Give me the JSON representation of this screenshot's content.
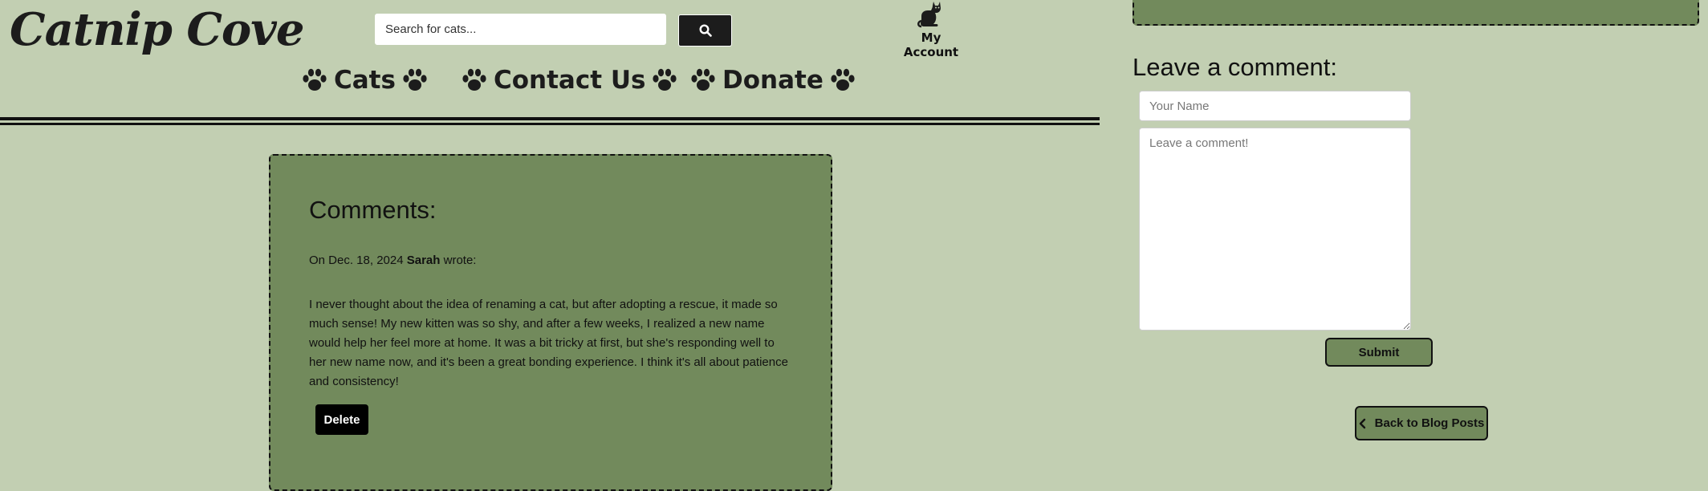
{
  "brand": {
    "name": "Catnip Cove"
  },
  "search": {
    "placeholder": "Search for cats...",
    "button_icon": "search-icon"
  },
  "account": {
    "label": "My Account",
    "icon": "cat-icon"
  },
  "nav": {
    "items": [
      {
        "label": "Cats",
        "icon": "paw-icon"
      },
      {
        "label": "Contact Us",
        "icon": "paw-icon"
      },
      {
        "label": "Donate",
        "icon": "paw-icon"
      }
    ]
  },
  "comments": {
    "title": "Comments:",
    "items": [
      {
        "date_prefix": "On Dec. 18, 2024 ",
        "author": "Sarah",
        "suffix": " wrote:",
        "text": "I never thought about the idea of renaming a cat, but after adopting a rescue, it made so much sense! My new kitten was so shy, and after a few weeks, I realized a new name would help her feel more at home. It was a bit tricky at first, but she's responding well to her new name now, and it's been a great bonding experience. I think it's all about patience and consistency!",
        "delete_label": "Delete"
      }
    ]
  },
  "form": {
    "heading": "Leave a comment:",
    "name_placeholder": "Your Name",
    "comment_placeholder": "Leave a comment!",
    "submit_label": "Submit"
  },
  "back": {
    "label": "Back to Blog Posts",
    "icon": "chevron-left-icon"
  },
  "colors": {
    "background": "#c2cfb2",
    "card": "#728a5c",
    "dark": "#1c1c1c"
  }
}
